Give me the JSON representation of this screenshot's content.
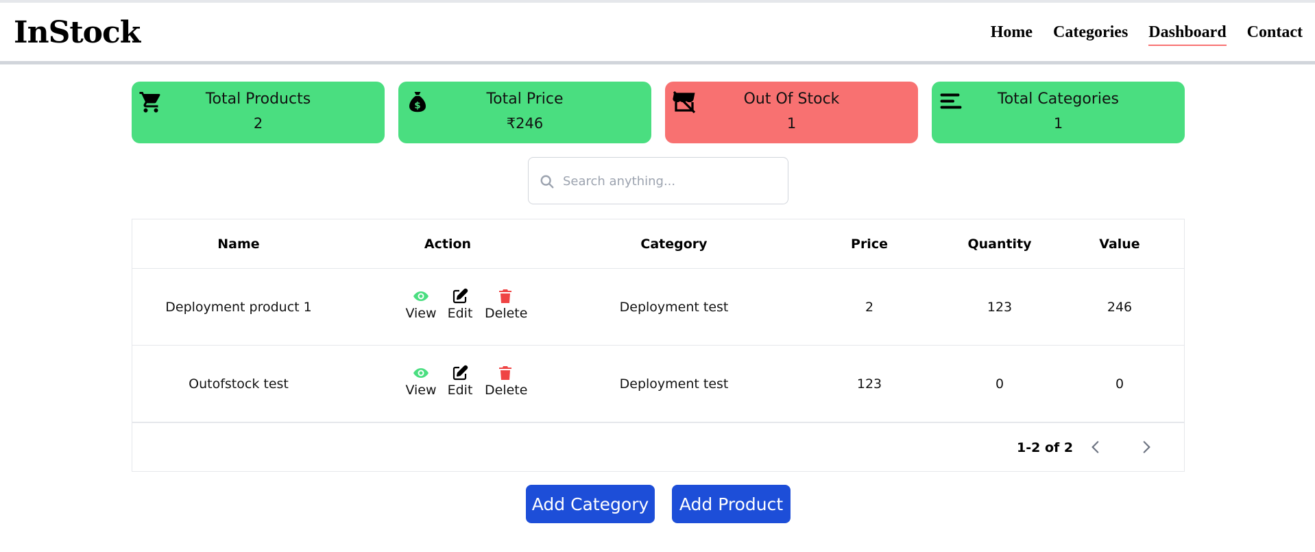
{
  "app": {
    "logo": "InStock"
  },
  "nav": [
    {
      "label": "Home",
      "active": false
    },
    {
      "label": "Categories",
      "active": false
    },
    {
      "label": "Dashboard",
      "active": true
    },
    {
      "label": "Contact",
      "active": false
    }
  ],
  "stats": [
    {
      "title": "Total Products",
      "value": "2",
      "icon": "cart-icon",
      "color": "#4ade80"
    },
    {
      "title": "Total Price",
      "value": "₹246",
      "icon": "money-bag-icon",
      "color": "#4ade80"
    },
    {
      "title": "Out Of Stock",
      "value": "1",
      "icon": "store-off-icon",
      "color": "#f87171"
    },
    {
      "title": "Total Categories",
      "value": "1",
      "icon": "menu-lines-icon",
      "color": "#4ade80"
    }
  ],
  "search": {
    "placeholder": "Search anything..."
  },
  "table": {
    "columns": [
      "Name",
      "Action",
      "Category",
      "Price",
      "Quantity",
      "Value"
    ],
    "actions": {
      "view": "View",
      "edit": "Edit",
      "delete": "Delete"
    },
    "rows": [
      {
        "name": "Deployment product 1",
        "category": "Deployment test",
        "price": "2",
        "quantity": "123",
        "value": "246"
      },
      {
        "name": "Outofstock test",
        "category": "Deployment test",
        "price": "123",
        "quantity": "0",
        "value": "0"
      }
    ]
  },
  "pagination": {
    "text": "1-2 of 2"
  },
  "buttons": {
    "add_category": "Add Category",
    "add_product": "Add Product"
  },
  "colors": {
    "green": "#4ade80",
    "red": "#f87171",
    "blue": "#1d4ed8",
    "nav_underline": "#f87171",
    "view_icon": "#4ade80",
    "delete_icon": "#ef4444"
  }
}
